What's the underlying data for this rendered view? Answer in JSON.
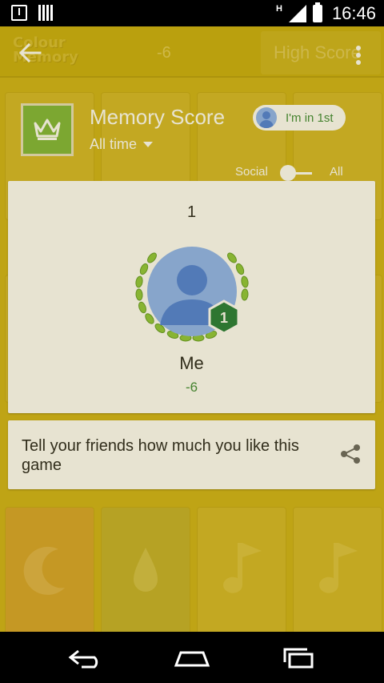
{
  "status_bar": {
    "network_label": "H",
    "time": "16:46"
  },
  "app_bar": {
    "logo_line1": "Colour",
    "logo_line2": "Memory",
    "score": "-6",
    "high_score_label": "High Score"
  },
  "leaderboard": {
    "title": "Memory Score",
    "time_filter": "All time",
    "rank_chip": "I'm in 1st",
    "toggle_left": "Social",
    "toggle_right": "All"
  },
  "winner_card": {
    "rank": "1",
    "badge_rank": "1",
    "player_name": "Me",
    "player_score": "-6"
  },
  "share_card": {
    "text": "Tell your friends how much you like this game"
  },
  "colors": {
    "background_yellow": "#cfb31a",
    "game_icon_green": "#7db63c",
    "score_green": "#3a8a3a",
    "badge_green": "#1e7a3c",
    "avatar_blue": "#4a7fe0"
  }
}
